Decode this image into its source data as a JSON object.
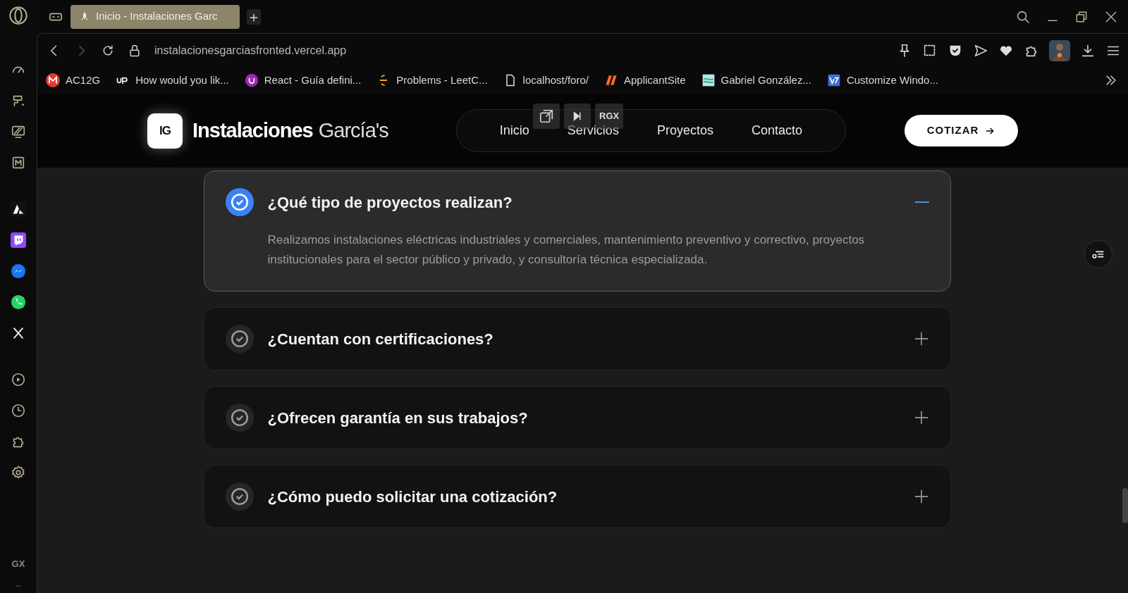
{
  "browser": {
    "tab_title": "Inicio - Instalaciones Garc",
    "address": "instalacionesgarciasfronted.vercel.app",
    "bookmarks": [
      {
        "label": "AC12G"
      },
      {
        "label": "How would you lik..."
      },
      {
        "label": "React - Guía defini..."
      },
      {
        "label": "Problems - LeetC..."
      },
      {
        "label": "localhost/foro/"
      },
      {
        "label": "ApplicantSite"
      },
      {
        "label": "Gabriel González..."
      },
      {
        "label": "Customize Windo..."
      }
    ],
    "sidebar_label": "GX"
  },
  "site": {
    "logo": "IG",
    "brand_bold": "Instalaciones",
    "brand_light": "García's",
    "nav": [
      {
        "label": "Inicio"
      },
      {
        "label": "Servicios"
      },
      {
        "label": "Proyectos"
      },
      {
        "label": "Contacto"
      }
    ],
    "cta": "COTIZAR"
  },
  "video_overlay": {
    "label": "RGX"
  },
  "faq": [
    {
      "question": "¿Qué tipo de proyectos realizan?",
      "expanded": true,
      "answer": "Realizamos instalaciones eléctricas industriales y comerciales, mantenimiento preventivo y correctivo, proyectos institucionales para el sector público y privado, y consultoría técnica especializada."
    },
    {
      "question": "¿Cuentan con certificaciones?",
      "expanded": false
    },
    {
      "question": "¿Ofrecen garantía en sus trabajos?",
      "expanded": false
    },
    {
      "question": "¿Cómo puedo solicitar una cotización?",
      "expanded": false
    }
  ]
}
